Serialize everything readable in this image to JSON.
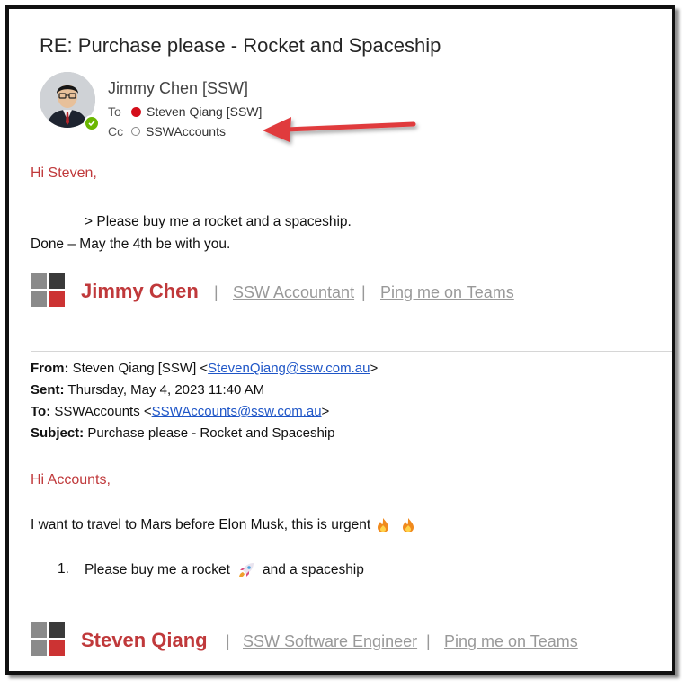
{
  "email": {
    "subject": "RE: Purchase please - Rocket and Spaceship",
    "sender": "Jimmy Chen [SSW]",
    "to_label": "To",
    "to_value": "Steven Qiang [SSW]",
    "cc_label": "Cc",
    "cc_value": "SSWAccounts"
  },
  "reply": {
    "greeting": "Hi Steven,",
    "quote": "> Please buy me a rocket and a spaceship.",
    "response": "Done – May the 4th be with you.",
    "signature": {
      "name": "Jimmy Chen",
      "sep": "|",
      "title": "SSW Accountant",
      "teams": "Ping me on Teams"
    }
  },
  "original": {
    "from_label": "From:",
    "from_name": "Steven Qiang [SSW] <",
    "from_email": "StevenQiang@ssw.com.au",
    "from_close": ">",
    "sent_label": "Sent:",
    "sent_value": "Thursday, May 4, 2023 11:40 AM",
    "to_label": "To:",
    "to_name": "SSWAccounts <",
    "to_email": "SSWAccounts@ssw.com.au",
    "to_close": ">",
    "subject_label": "Subject:",
    "subject_value": "Purchase please - Rocket and Spaceship",
    "greeting": "Hi Accounts,",
    "line1": "I want to travel to Mars before Elon Musk, this is urgent",
    "list_number": "1.",
    "list_text_a": "Please buy me a rocket",
    "list_text_b": "and a spaceship",
    "signature": {
      "name": "Steven Qiang",
      "sep": "|",
      "title": "SSW Software Engineer",
      "teams": "Ping me on Teams"
    }
  },
  "icons": {
    "presence": "presence-available-icon",
    "arrow": "red-arrow-annotation",
    "fire": "fire-emoji",
    "rocket": "rocket-emoji",
    "logo": "ssw-logo"
  },
  "colors": {
    "accent_red": "#c0393b",
    "link_blue": "#1f56c7",
    "presence_green": "#6bb700",
    "arrow_red": "#e03a3e"
  }
}
